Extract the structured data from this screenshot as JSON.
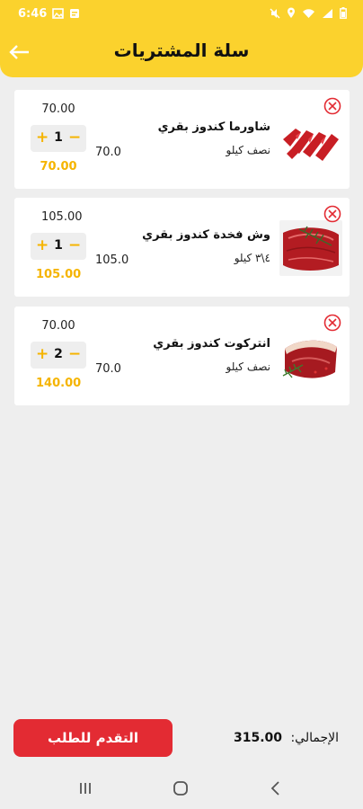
{
  "status_bar": {
    "time": "6:46",
    "icons_left": [
      "image-icon",
      "message-icon"
    ],
    "icons_right": [
      "mute-icon",
      "location-icon",
      "wifi-icon",
      "signal-icon",
      "battery-icon"
    ]
  },
  "header": {
    "title": "سلة المشتريات",
    "back_icon": "arrow-left-icon"
  },
  "cart": {
    "items": [
      {
        "price": "70.00",
        "qty": "1",
        "total": "70.00",
        "unit_price": "70.0",
        "name": "شاورما كندوز بقري",
        "weight": "نصف كيلو",
        "image": "sliced-red-meat"
      },
      {
        "price": "105.00",
        "qty": "1",
        "total": "105.00",
        "unit_price": "105.0",
        "name": "وش فخدة كندوز بقري",
        "weight": "٤\\٣ كيلو",
        "image": "beef-steak-rosemary"
      },
      {
        "price": "70.00",
        "qty": "2",
        "total": "140.00",
        "unit_price": "70.0",
        "name": "انتركوت كندوز بقري",
        "weight": "نصف كيلو",
        "image": "beef-steak-herbs"
      }
    ]
  },
  "footer": {
    "checkout_label": "التقدم للطلب",
    "total_label": "الإجمالي:",
    "total_value": "315.00"
  },
  "colors": {
    "accent": "#fbd22d",
    "stepper_icons": "#f5b400",
    "checkout": "#e32b33",
    "remove": "#e32b33"
  }
}
